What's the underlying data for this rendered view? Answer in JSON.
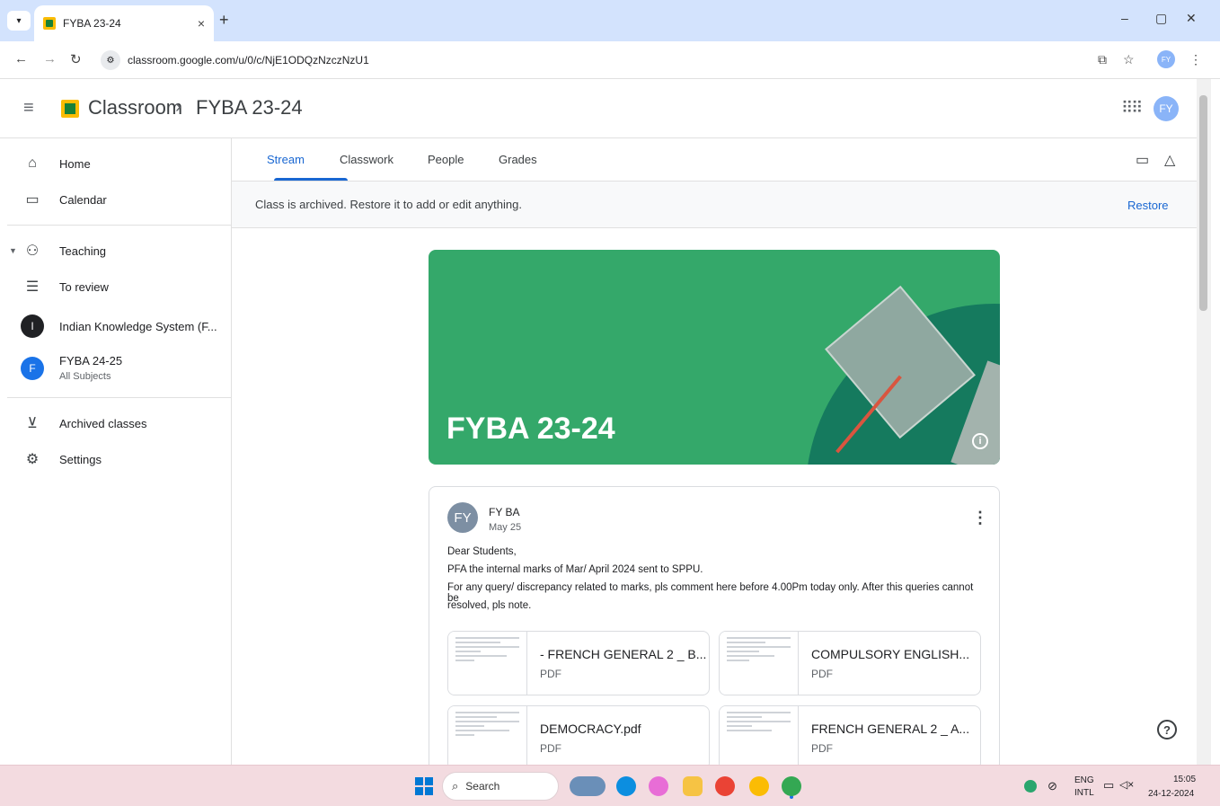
{
  "browser": {
    "tab_title": "FYBA 23-24",
    "tab_close": "×",
    "new_tab": "+",
    "url": "classroom.google.com/u/0/c/NjE1ODQzNzczNzU1",
    "avatar": "FY",
    "controls": {
      "minimize": "–",
      "restore": "▢",
      "close": "✕"
    }
  },
  "header": {
    "app_name": "Classroom",
    "separator": "›",
    "class_title": "FYBA 23-24",
    "avatar": "FY"
  },
  "sidebar": {
    "home": "Home",
    "calendar": "Calendar",
    "teaching": "Teaching",
    "to_review": "To review",
    "classes": [
      {
        "initial": "I",
        "name": "Indian Knowledge System (F...",
        "sub": "",
        "color": "#202124"
      },
      {
        "initial": "F",
        "name": "FYBA 24-25",
        "sub": "All Subjects",
        "color": "#1a73e8"
      }
    ],
    "archived": "Archived classes",
    "settings": "Settings"
  },
  "tabs": [
    "Stream",
    "Classwork",
    "People",
    "Grades"
  ],
  "archived_notice": {
    "message": "Class is archived. Restore it to add or edit anything.",
    "action": "Restore"
  },
  "banner": {
    "title": "FYBA 23-24",
    "bg_color": "#34a86a"
  },
  "post": {
    "avatar": "FY",
    "author": "FY BA",
    "date": "May 25",
    "lines": [
      "Dear Students,",
      "PFA the internal marks of Mar/ April 2024 sent to SPPU.",
      "For any query/ discrepancy related to marks, pls comment here before 4.00Pm today only. After this queries cannot be",
      "resolved, pls note."
    ],
    "attachments": [
      {
        "name": "- FRENCH GENERAL 2 _ B...",
        "type": "PDF"
      },
      {
        "name": "COMPULSORY ENGLISH...",
        "type": "PDF"
      },
      {
        "name": "DEMOCRACY.pdf",
        "type": "PDF"
      },
      {
        "name": "FRENCH GENERAL 2 _ A...",
        "type": "PDF"
      }
    ]
  },
  "taskbar": {
    "search": "Search",
    "lang_top": "ENG",
    "lang_bottom": "INTL",
    "time": "15:05",
    "date": "24-12-2024"
  }
}
